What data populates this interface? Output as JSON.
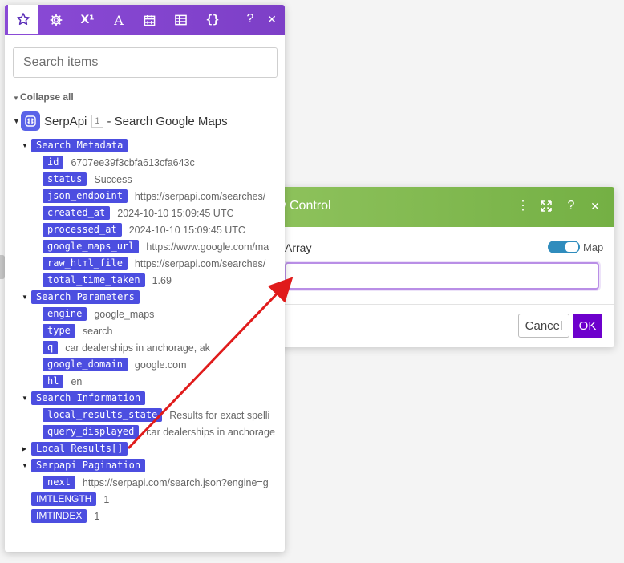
{
  "dialog": {
    "title": "w Control",
    "field_label": "Array",
    "map_label": "Map",
    "array_value": "",
    "cancel_label": "Cancel",
    "ok_label": "OK",
    "header_icons": {
      "menu": "⋮",
      "expand": "⤢",
      "help": "?",
      "close": "✕"
    }
  },
  "panel": {
    "tabs": {
      "superscript": "X¹",
      "text": "A",
      "functions": "{}"
    },
    "tab_help": "?",
    "tab_close": "✕",
    "search_placeholder": "Search items",
    "collapse_all": "Collapse all",
    "module": {
      "name": "SerpApi",
      "badge": "1",
      "title": "- Search Google Maps"
    },
    "search_metadata": {
      "label": "Search Metadata",
      "items": [
        {
          "key": "id",
          "value": "6707ee39f3cbfa613cfa643c"
        },
        {
          "key": "status",
          "value": "Success"
        },
        {
          "key": "json_endpoint",
          "value": "https://serpapi.com/searches/"
        },
        {
          "key": "created_at",
          "value": "2024-10-10 15:09:45 UTC"
        },
        {
          "key": "processed_at",
          "value": "2024-10-10 15:09:45 UTC"
        },
        {
          "key": "google_maps_url",
          "value": "https://www.google.com/ma"
        },
        {
          "key": "raw_html_file",
          "value": "https://serpapi.com/searches/"
        },
        {
          "key": "total_time_taken",
          "value": "1.69"
        }
      ]
    },
    "search_parameters": {
      "label": "Search Parameters",
      "items": [
        {
          "key": "engine",
          "value": "google_maps"
        },
        {
          "key": "type",
          "value": "search"
        },
        {
          "key": "q",
          "value": "car dealerships in anchorage, ak"
        },
        {
          "key": "google_domain",
          "value": "google.com"
        },
        {
          "key": "hl",
          "value": "en"
        }
      ]
    },
    "search_information": {
      "label": "Search Information",
      "items": [
        {
          "key": "local_results_state",
          "value": "Results for exact spelli"
        },
        {
          "key": "query_displayed",
          "value": "car dealerships in anchorage"
        }
      ]
    },
    "local_results": {
      "label": "Local Results[]"
    },
    "serpapi_pagination": {
      "label": "Serpapi Pagination",
      "items": [
        {
          "key": "next",
          "value": "https://serpapi.com/search.json?engine=g"
        }
      ]
    },
    "imtlength": {
      "key": "IMTLENGTH",
      "value": "1"
    },
    "imtindex": {
      "key": "IMTINDEX",
      "value": "1"
    }
  },
  "colors": {
    "tab_bar": "#8a4ad6",
    "tag": "#4c4ee0",
    "dialog_header": "#7fb84f",
    "ok_button": "#6d00cc",
    "arrow": "#e01b1b"
  }
}
